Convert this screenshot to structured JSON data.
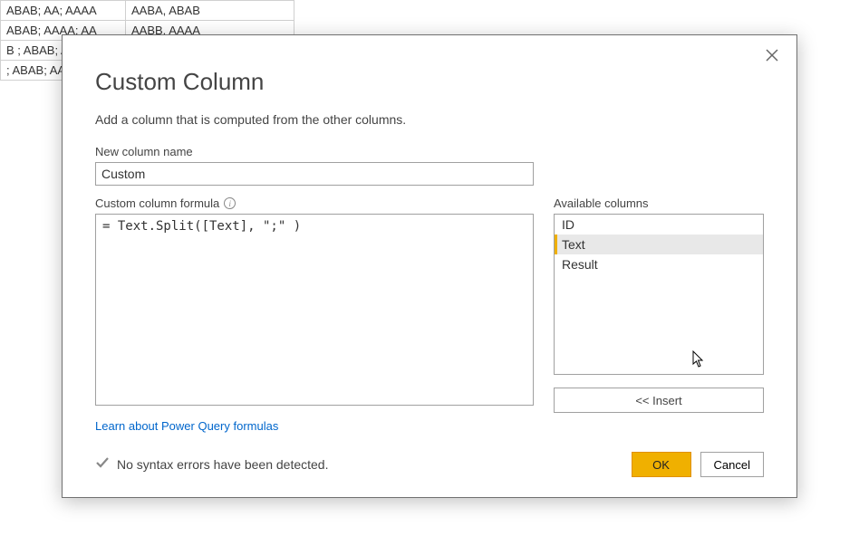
{
  "background_table": {
    "rows": [
      {
        "a": "ABAB; AA; AAAA",
        "b": "AABA, ABAB"
      },
      {
        "a": "ABAB; AAAA: AA",
        "b": "AABB. AAAA"
      },
      {
        "a": "B ; ABAB; AA",
        "b": ""
      },
      {
        "a": "; ABAB; AA; .",
        "b": ""
      }
    ]
  },
  "dialog": {
    "title": "Custom Column",
    "subtitle": "Add a column that is computed from the other columns.",
    "name_label": "New column name",
    "name_value": "Custom",
    "formula_label": "Custom column formula",
    "formula_value": "= Text.Split([Text], \";\" )",
    "available_label": "Available columns",
    "available_items": [
      "ID",
      "Text",
      "Result"
    ],
    "selected_index": 1,
    "insert_label": "<< Insert",
    "learn_link": "Learn about Power Query formulas",
    "status_text": "No syntax errors have been detected.",
    "ok_label": "OK",
    "cancel_label": "Cancel"
  }
}
